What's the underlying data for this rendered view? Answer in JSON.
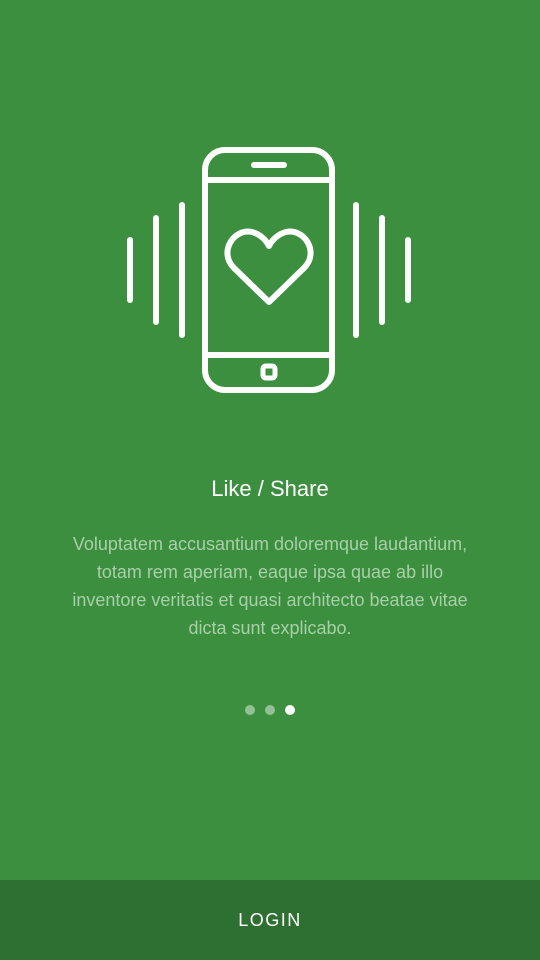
{
  "onboarding": {
    "illustration_icon": "phone-heart-vibrate-icon",
    "title": "Like / Share",
    "description": "Voluptatem accusantium doloremque laudantium, totam rem aperiam, eaque ipsa quae ab illo inventore veritatis et quasi architecto beatae vitae dicta sunt explicabo.",
    "page_indicator": {
      "total": 3,
      "active_index": 2
    }
  },
  "footer": {
    "login_label": "LOGIN"
  },
  "colors": {
    "background": "#3b8f3e",
    "footer_background": "#2e7031",
    "title_text": "#ffffff",
    "description_text": "#a9cfa9"
  }
}
